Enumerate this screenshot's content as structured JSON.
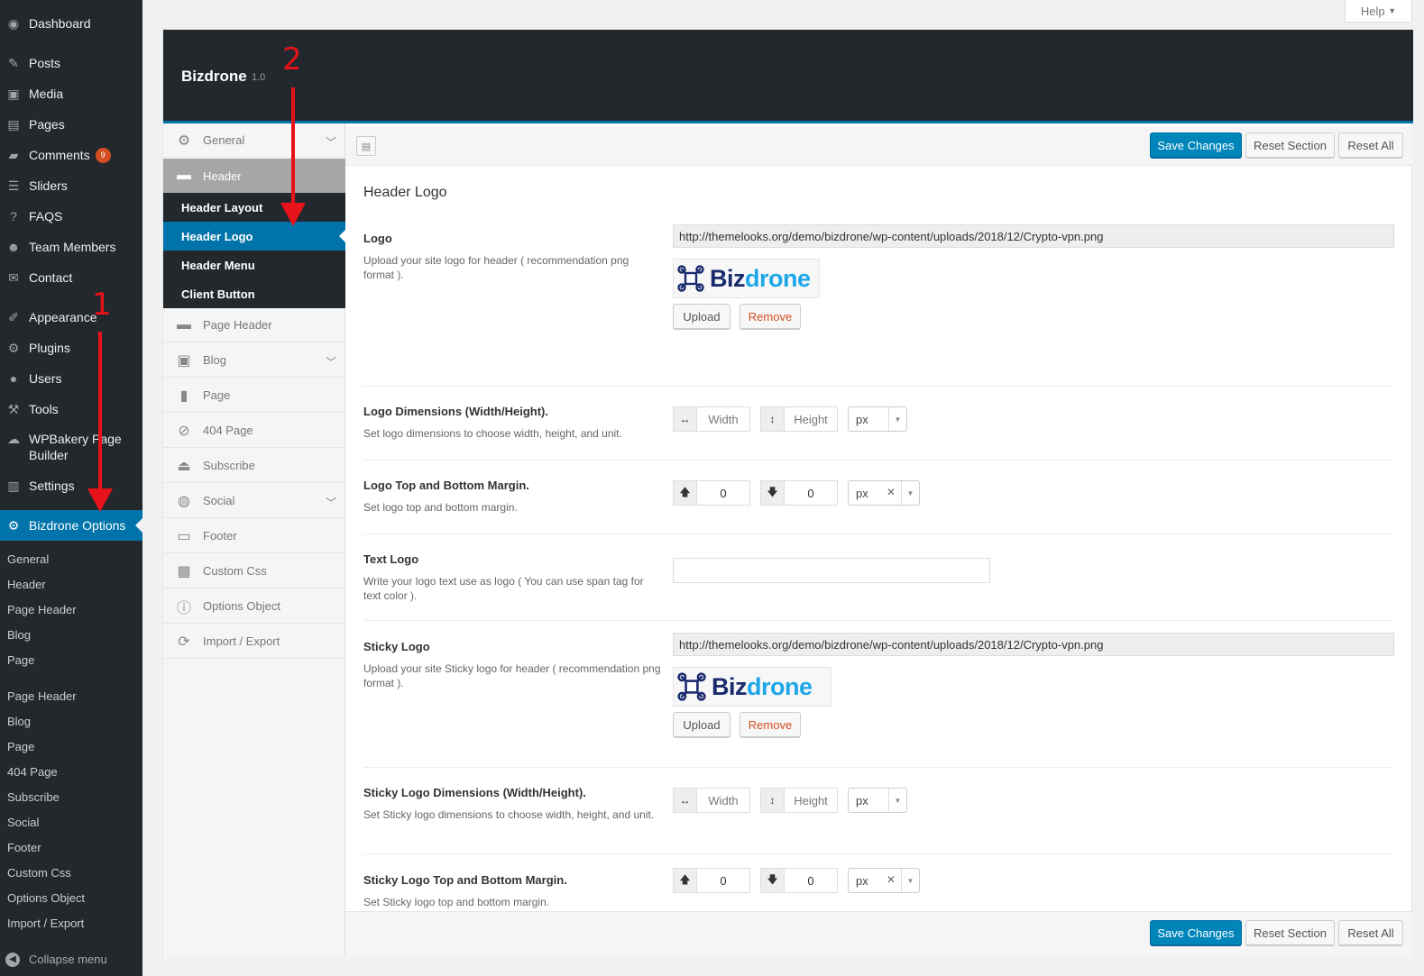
{
  "help": {
    "label": "Help"
  },
  "wp_menu": {
    "items": [
      {
        "label": "Dashboard",
        "icon": "dashboard-icon"
      },
      {
        "label": "Posts",
        "icon": "pin-icon"
      },
      {
        "label": "Media",
        "icon": "media-icon"
      },
      {
        "label": "Pages",
        "icon": "pages-icon"
      },
      {
        "label": "Comments",
        "icon": "comment-icon",
        "badge": "9"
      },
      {
        "label": "Sliders",
        "icon": "slides-icon"
      },
      {
        "label": "FAQS",
        "icon": "help-icon"
      },
      {
        "label": "Team Members",
        "icon": "groups-icon"
      },
      {
        "label": "Contact",
        "icon": "mail-icon"
      },
      {
        "label": "Appearance",
        "icon": "brush-icon"
      },
      {
        "label": "Plugins",
        "icon": "plugin-icon"
      },
      {
        "label": "Users",
        "icon": "user-icon"
      },
      {
        "label": "Tools",
        "icon": "wrench-icon"
      },
      {
        "label": "WPBakery Page Builder",
        "icon": "cloud-icon"
      },
      {
        "label": "Settings",
        "icon": "settings-icon"
      },
      {
        "label": "Bizdrone Options",
        "icon": "gear-icon"
      }
    ],
    "submenu": [
      "General",
      "Header",
      "Page Header",
      "Blog",
      "Page",
      "Page Header",
      "Blog",
      "Page",
      "404 Page",
      "Subscribe",
      "Social",
      "Footer",
      "Custom Css",
      "Options Object",
      "Import / Export"
    ],
    "collapse_label": "Collapse menu"
  },
  "panel": {
    "theme_name": "Bizdrone",
    "theme_version": "1.0"
  },
  "options_menu": {
    "items": [
      {
        "label": "General"
      },
      {
        "label": "Header"
      },
      {
        "label": "Page Header"
      },
      {
        "label": "Blog"
      },
      {
        "label": "Page"
      },
      {
        "label": "404 Page"
      },
      {
        "label": "Subscribe"
      },
      {
        "label": "Social"
      },
      {
        "label": "Footer"
      },
      {
        "label": "Custom Css"
      },
      {
        "label": "Options Object"
      },
      {
        "label": "Import / Export"
      }
    ],
    "header_sub": [
      "Header Layout",
      "Header Logo",
      "Header Menu",
      "Client Button"
    ]
  },
  "actions": {
    "save": "Save Changes",
    "reset_section": "Reset Section",
    "reset_all": "Reset All"
  },
  "section": {
    "title": "Header Logo",
    "fields": {
      "logo": {
        "title": "Logo",
        "desc": "Upload your site logo for header ( recommendation png format ).",
        "url": "http://themelooks.org/demo/bizdrone/wp-content/uploads/2018/12/Crypto-vpn.png"
      },
      "logo_dim": {
        "title": "Logo Dimensions (Width/Height).",
        "desc": "Set logo dimensions to choose width, height, and unit.",
        "width_ph": "Width",
        "height_ph": "Height",
        "unit": "px"
      },
      "logo_margin": {
        "title": "Logo Top and Bottom Margin.",
        "desc": "Set logo top and bottom margin.",
        "top": "0",
        "bottom": "0",
        "unit": "px"
      },
      "text_logo": {
        "title": "Text Logo",
        "desc": "Write your logo text use as logo ( You can use span tag for text color )."
      },
      "sticky_logo": {
        "title": "Sticky Logo",
        "desc": "Upload your site Sticky logo for header ( recommendation png format ).",
        "url": "http://themelooks.org/demo/bizdrone/wp-content/uploads/2018/12/Crypto-vpn.png"
      },
      "sticky_dim": {
        "title": "Sticky Logo Dimensions (Width/Height).",
        "desc": "Set Sticky logo dimensions to choose width, height, and unit.",
        "width_ph": "Width",
        "height_ph": "Height",
        "unit": "px"
      },
      "sticky_margin": {
        "title": "Sticky Logo Top and Bottom Margin.",
        "desc": "Set Sticky logo top and bottom margin.",
        "top": "0",
        "bottom": "0",
        "unit": "px"
      }
    },
    "upload_label": "Upload",
    "remove_label": "Remove",
    "logo_word_a": "Biz",
    "logo_word_b": "drone"
  },
  "annotations": {
    "one": "1",
    "two": "2"
  },
  "colors": {
    "admin_bar": "#23282d",
    "accent": "#0073aa",
    "primary_button": "#0085ba",
    "annotation": "#e8121a"
  }
}
